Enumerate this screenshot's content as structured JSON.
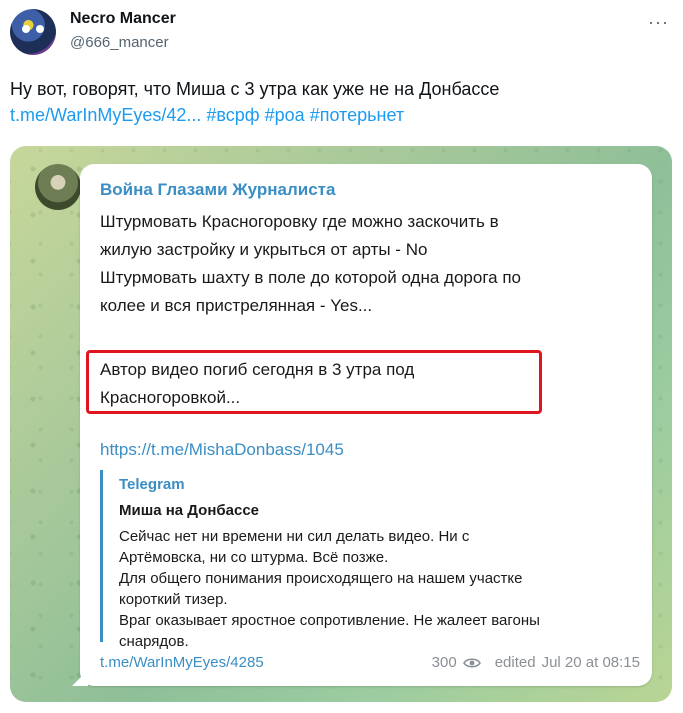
{
  "author": {
    "name": "Necro Mancer",
    "handle": "@666_mancer",
    "more_label": "···"
  },
  "tweet": {
    "text": "Ну вот, говорят, что Миша с 3 утра как уже не на Донбассе",
    "link": "t.me/WarInMyEyes/42...",
    "hashtags": [
      "#всрф",
      "#роа",
      "#потерьнет"
    ]
  },
  "telegram_post": {
    "channel_title": "Война Глазами Журналиста",
    "lines": [
      "Штурмовать Красногоровку где можно заскочить в",
      "жилую застройку и укрыться от арты - No",
      "Штурмовать шахту в поле до которой одна дорога по",
      "колее и вся пристрелянная - Yes..."
    ],
    "highlighted_lines": [
      "Автор видео погиб сегодня в 3 утра под",
      "Красногоровкой..."
    ],
    "url": "https://t.me/MishaDonbass/1045",
    "preview": {
      "site": "Telegram",
      "title": "Миша на Донбассе",
      "lines": [
        "Сейчас нет ни времени ни сил делать видео. Ни с",
        "Артёмовска, ни со штурма. Всё позже.",
        "Для общего понимания происходящего на нашем участке",
        "короткий тизер.",
        "Враг оказывает яростное сопротивление. Не жалеет вагоны",
        "снарядов."
      ]
    },
    "footer_link": "t.me/WarInMyEyes/4285",
    "views": "300",
    "edited": "edited",
    "timestamp": "Jul 20 at 08:15"
  },
  "colors": {
    "link_blue": "#1d9bf0",
    "telegram_blue": "#3a8ec4",
    "highlight_red": "#e0141e"
  }
}
